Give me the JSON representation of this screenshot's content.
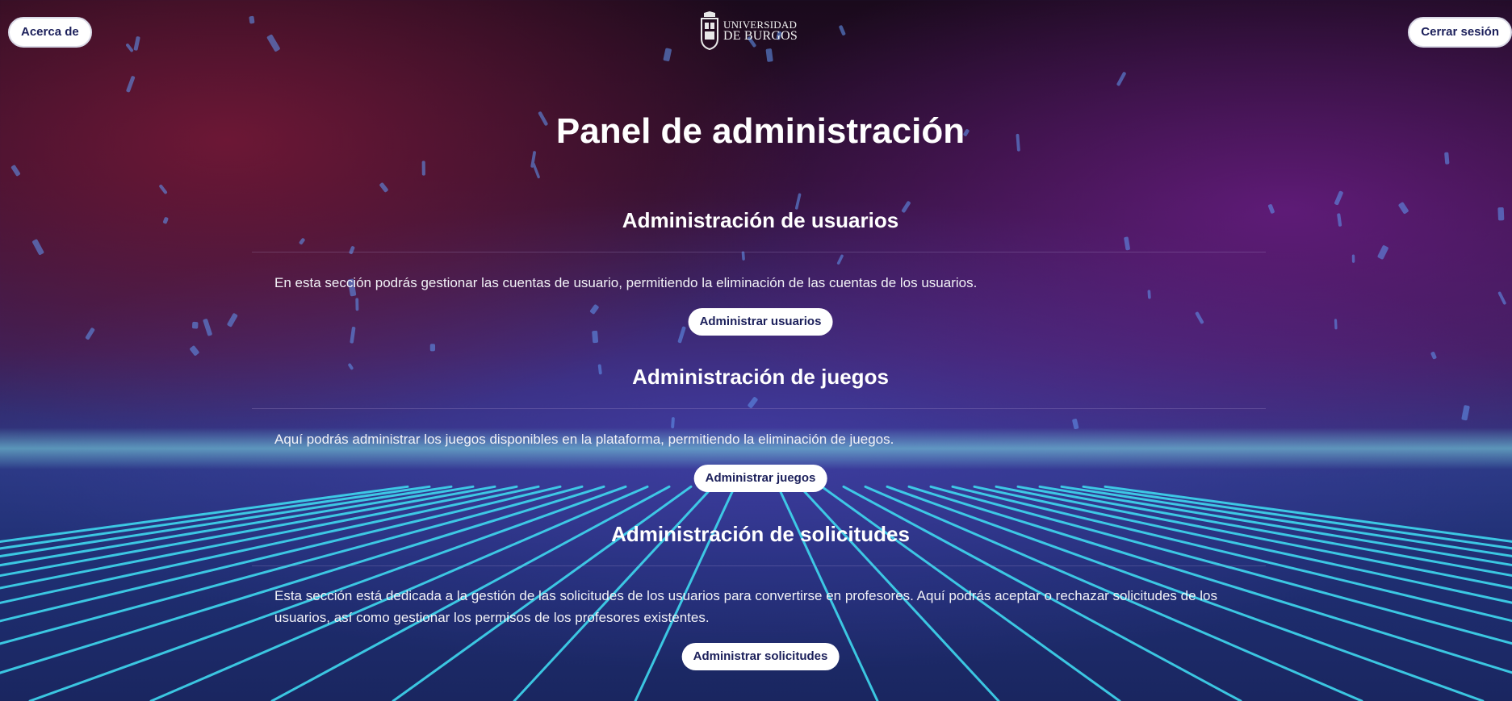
{
  "header": {
    "about_label": "Acerca de",
    "logout_label": "Cerrar sesión",
    "logo": {
      "line1": "UNIVERSIDAD",
      "line2": "DE BURGOS"
    }
  },
  "page_title": "Panel de administración",
  "sections": [
    {
      "title": "Administración de usuarios",
      "description": "En esta sección podrás gestionar las cuentas de usuario, permitiendo la eliminación de las cuentas de los usuarios.",
      "button_label": "Administrar usuarios"
    },
    {
      "title": "Administración de juegos",
      "description": "Aquí podrás administrar los juegos disponibles en la plataforma, permitiendo la eliminación de juegos.",
      "button_label": "Administrar juegos"
    },
    {
      "title": "Administración de solicitudes",
      "description": "Esta sección está dedicada a la gestión de las solicitudes de los usuarios para convertirse en profesores. Aquí podrás aceptar o rechazar solicitudes de los usuarios, así como gestionar los permisos de los profesores existentes.",
      "button_label": "Administrar solicitudes"
    }
  ],
  "colors": {
    "button_bg": "#ffffff",
    "button_text": "#1b1f5a",
    "grid_line": "#3fd8ef",
    "horizon_glow": "#7fe3e6"
  }
}
